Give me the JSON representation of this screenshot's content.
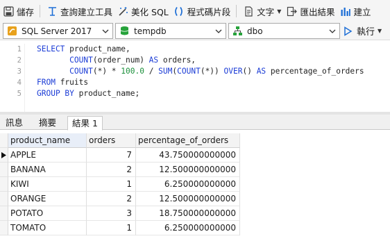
{
  "colors": {
    "accent": "#1e6fd6",
    "keyword": "#1b3cd6",
    "number": "#1a8f3a"
  },
  "toolbar": {
    "save_label": "儲存",
    "query_builder_label": "查詢建立工具",
    "beautify_label": "美化 SQL",
    "snippet_label": "程式碼片段",
    "text_label": "文字",
    "export_label": "匯出結果",
    "build_label": "建立"
  },
  "selectors": {
    "server": "SQL Server 2017",
    "database": "tempdb",
    "schema": "dbo",
    "run_label": "執行"
  },
  "editor": {
    "line_numbers": [
      "1",
      "2",
      "3",
      "4",
      "5"
    ]
  },
  "tabs": {
    "messages": "訊息",
    "summary": "摘要",
    "result": "結果 1"
  },
  "grid": {
    "columns": [
      "product_name",
      "orders",
      "percentage_of_orders"
    ],
    "rows": [
      {
        "product_name": "APPLE",
        "orders": "7",
        "percentage": "43.750000000000"
      },
      {
        "product_name": "BANANA",
        "orders": "2",
        "percentage": "12.500000000000"
      },
      {
        "product_name": "KIWI",
        "orders": "1",
        "percentage": "6.250000000000"
      },
      {
        "product_name": "ORANGE",
        "orders": "2",
        "percentage": "12.500000000000"
      },
      {
        "product_name": "POTATO",
        "orders": "3",
        "percentage": "18.750000000000"
      },
      {
        "product_name": "TOMATO",
        "orders": "1",
        "percentage": "6.250000000000"
      }
    ]
  }
}
